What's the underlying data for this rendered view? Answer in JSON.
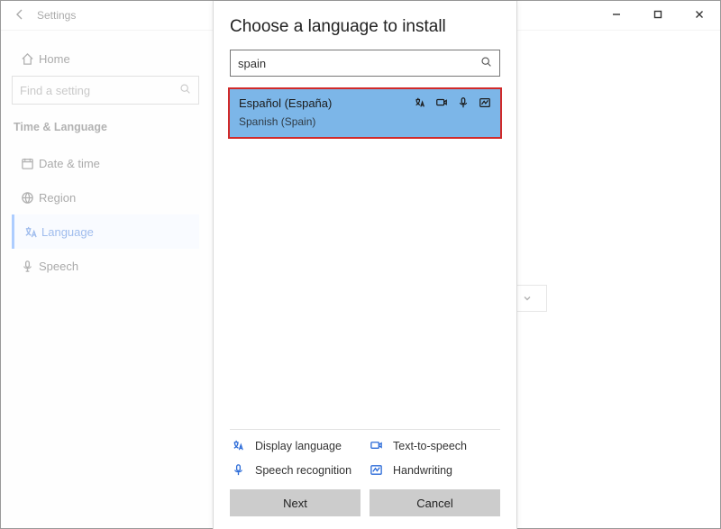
{
  "window": {
    "title": "Settings"
  },
  "sidebar": {
    "home": "Home",
    "search_placeholder": "Find a setting",
    "section_heading": "Time & Language",
    "items": [
      {
        "label": "Date & time"
      },
      {
        "label": "Region"
      },
      {
        "label": "Language"
      },
      {
        "label": "Speech"
      }
    ]
  },
  "dialog": {
    "title": "Choose a language to install",
    "search_value": "spain",
    "result": {
      "native": "Español (España)",
      "english": "Spanish (Spain)"
    },
    "features": {
      "display": "Display language",
      "tts": "Text-to-speech",
      "speech": "Speech recognition",
      "handwriting": "Handwriting"
    },
    "buttons": {
      "next": "Next",
      "cancel": "Cancel"
    }
  }
}
